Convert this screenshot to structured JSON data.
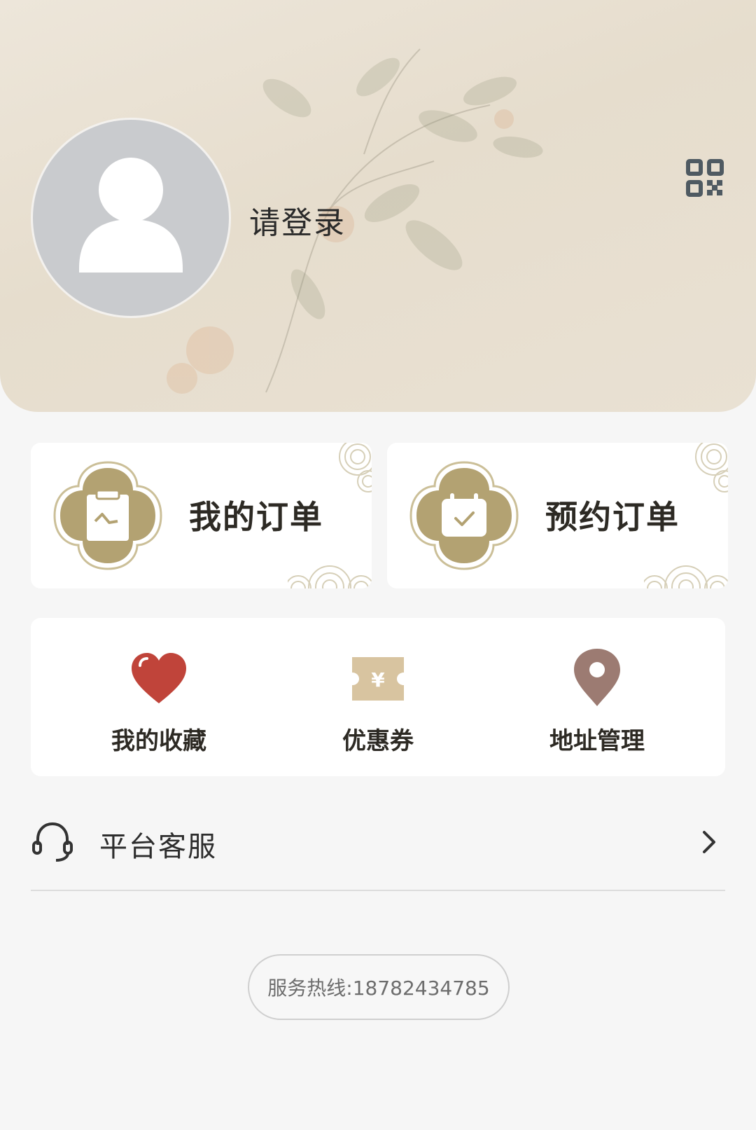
{
  "profile": {
    "login_label": "请登录"
  },
  "orders": [
    {
      "label": "我的订单",
      "icon": "clipboard-icon"
    },
    {
      "label": "预约订单",
      "icon": "calendar-check-icon"
    }
  ],
  "quick_actions": [
    {
      "label": "我的收藏",
      "icon": "heart-icon",
      "color": "#c0443a"
    },
    {
      "label": "优惠券",
      "icon": "coupon-icon",
      "color": "#d8c4a0"
    },
    {
      "label": "地址管理",
      "icon": "location-pin-icon",
      "color": "#9c7b72"
    }
  ],
  "service": {
    "label": "平台客服",
    "icon": "headset-icon"
  },
  "hotline": {
    "text": "服务热线:18782434785"
  },
  "colors": {
    "accent_gold": "#b3a272",
    "page_bg": "#f6f6f6"
  }
}
